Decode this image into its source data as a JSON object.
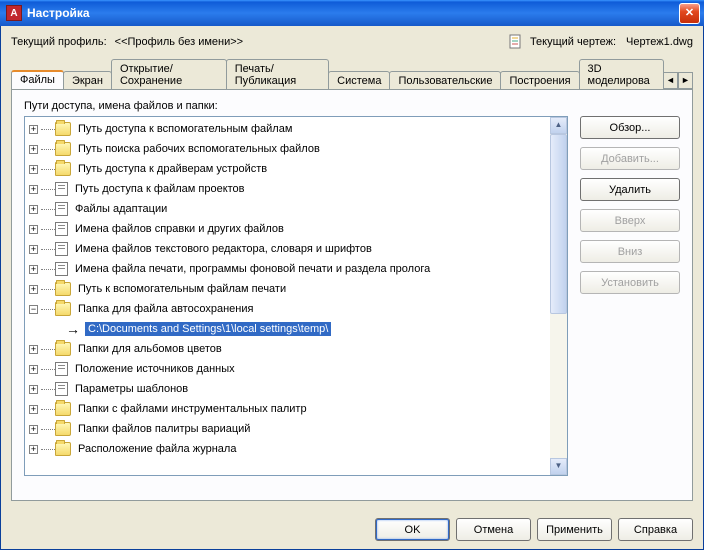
{
  "title": "Настройка",
  "profile_row": {
    "label": "Текущий профиль:",
    "name": "<<Профиль без имени>>",
    "drawing_label": "Текущий чертеж:",
    "drawing_name": "Чертеж1.dwg"
  },
  "tabs": [
    {
      "label": "Файлы",
      "active": true
    },
    {
      "label": "Экран",
      "active": false
    },
    {
      "label": "Открытие/Сохранение",
      "active": false
    },
    {
      "label": "Печать/Публикация",
      "active": false
    },
    {
      "label": "Система",
      "active": false
    },
    {
      "label": "Пользовательские",
      "active": false
    },
    {
      "label": "Построения",
      "active": false
    },
    {
      "label": "3D моделирова",
      "active": false
    }
  ],
  "paths_label": "Пути доступа, имена файлов и папки:",
  "tree": [
    {
      "exp": "+",
      "icon": "folder",
      "label": "Путь доступа к вспомогательным файлам"
    },
    {
      "exp": "+",
      "icon": "folder",
      "label": "Путь поиска рабочих вспомогательных файлов"
    },
    {
      "exp": "+",
      "icon": "folder",
      "label": "Путь доступа к драйверам устройств"
    },
    {
      "exp": "+",
      "icon": "file",
      "label": "Путь доступа к файлам проектов"
    },
    {
      "exp": "+",
      "icon": "file",
      "label": "Файлы адаптации"
    },
    {
      "exp": "+",
      "icon": "file",
      "label": "Имена файлов справки и других файлов"
    },
    {
      "exp": "+",
      "icon": "file",
      "label": "Имена файлов текстового редактора, словаря и шрифтов"
    },
    {
      "exp": "+",
      "icon": "file",
      "label": "Имена файла печати, программы фоновой печати и раздела пролога"
    },
    {
      "exp": "+",
      "icon": "folder",
      "label": "Путь к вспомогательным файлам печати"
    },
    {
      "exp": "-",
      "icon": "folder",
      "label": "Папка для файла автосохранения"
    },
    {
      "exp": "child",
      "icon": "arrow",
      "label": "C:\\Documents and Settings\\1\\local settings\\temp\\",
      "selected": true
    },
    {
      "exp": "+",
      "icon": "folder",
      "label": "Папки для альбомов цветов"
    },
    {
      "exp": "+",
      "icon": "file",
      "label": "Положение источников данных"
    },
    {
      "exp": "+",
      "icon": "file",
      "label": "Параметры шаблонов"
    },
    {
      "exp": "+",
      "icon": "folder",
      "label": "Папки с файлами инструментальных палитр"
    },
    {
      "exp": "+",
      "icon": "folder",
      "label": "Папки файлов палитры вариаций"
    },
    {
      "exp": "+",
      "icon": "folder",
      "label": "Расположение файла журнала"
    }
  ],
  "side_buttons": {
    "browse": "Обзор...",
    "add": "Добавить...",
    "delete": "Удалить",
    "up": "Вверх",
    "down": "Вниз",
    "set": "Установить"
  },
  "bottom_buttons": {
    "ok": "OK",
    "cancel": "Отмена",
    "apply": "Применить",
    "help": "Справка"
  }
}
